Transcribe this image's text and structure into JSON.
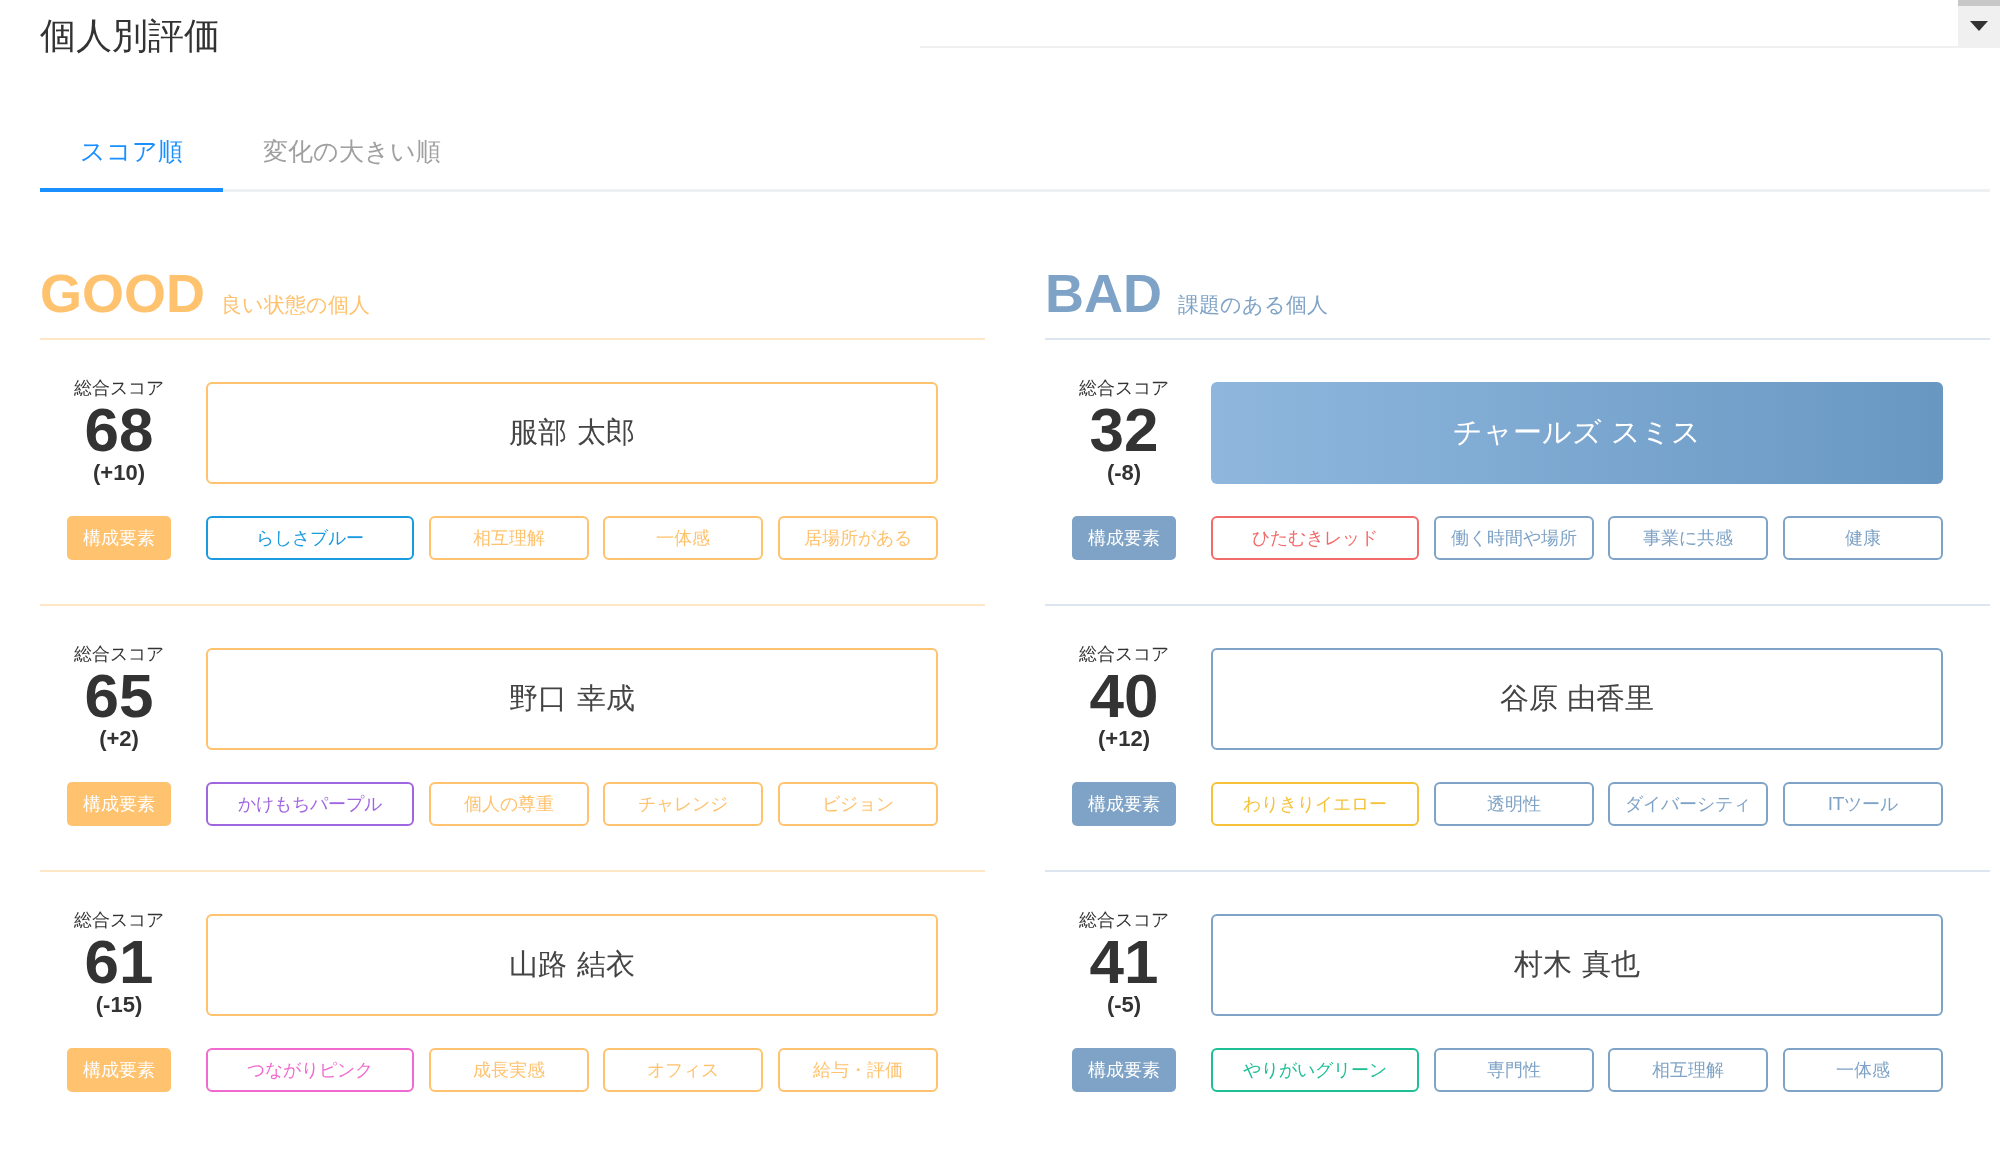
{
  "title": "個人別評価",
  "tabs": [
    {
      "label": "スコア順",
      "selected": true
    },
    {
      "label": "変化の大きい順",
      "selected": false
    }
  ],
  "sections": [
    {
      "kind": "good",
      "heading": "GOOD",
      "subheading": "良い状態の個人",
      "people": [
        {
          "score_label": "総合スコア",
          "score": "68",
          "change": "(+10)",
          "name": "服部 太郎",
          "highlighted": false,
          "components_label": "構成要素",
          "tags": [
            {
              "label": "らしさブルー",
              "color": "#1a9be0"
            },
            {
              "label": "相互理解",
              "color": "#ffc26e"
            },
            {
              "label": "一体感",
              "color": "#ffc26e"
            },
            {
              "label": "居場所がある",
              "color": "#ffc26e"
            }
          ]
        },
        {
          "score_label": "総合スコア",
          "score": "65",
          "change": "(+2)",
          "name": "野口 幸成",
          "highlighted": false,
          "components_label": "構成要素",
          "tags": [
            {
              "label": "かけもちパープル",
              "color": "#a066e0"
            },
            {
              "label": "個人の尊重",
              "color": "#ffc26e"
            },
            {
              "label": "チャレンジ",
              "color": "#ffc26e"
            },
            {
              "label": "ビジョン",
              "color": "#ffc26e"
            }
          ]
        },
        {
          "score_label": "総合スコア",
          "score": "61",
          "change": "(-15)",
          "name": "山路 結衣",
          "highlighted": false,
          "components_label": "構成要素",
          "tags": [
            {
              "label": "つながりピンク",
              "color": "#f06ad0"
            },
            {
              "label": "成長実感",
              "color": "#ffc26e"
            },
            {
              "label": "オフィス",
              "color": "#ffc26e"
            },
            {
              "label": "給与・評価",
              "color": "#ffc26e"
            }
          ]
        }
      ]
    },
    {
      "kind": "bad",
      "heading": "BAD",
      "subheading": "課題のある個人",
      "people": [
        {
          "score_label": "総合スコア",
          "score": "32",
          "change": "(-8)",
          "name": "チャールズ スミス",
          "highlighted": true,
          "components_label": "構成要素",
          "tags": [
            {
              "label": "ひたむきレッド",
              "color": "#f26b6b"
            },
            {
              "label": "働く時間や場所",
              "color": "#7fa3c6"
            },
            {
              "label": "事業に共感",
              "color": "#7fa3c6"
            },
            {
              "label": "健康",
              "color": "#7fa3c6"
            }
          ]
        },
        {
          "score_label": "総合スコア",
          "score": "40",
          "change": "(+12)",
          "name": "谷原 由香里",
          "highlighted": false,
          "components_label": "構成要素",
          "tags": [
            {
              "label": "わりきりイエロー",
              "color": "#f5c23a"
            },
            {
              "label": "透明性",
              "color": "#7fa3c6"
            },
            {
              "label": "ダイバーシティ",
              "color": "#7fa3c6"
            },
            {
              "label": "ITツール",
              "color": "#7fa3c6"
            }
          ]
        },
        {
          "score_label": "総合スコア",
          "score": "41",
          "change": "(-5)",
          "name": "村木 真也",
          "highlighted": false,
          "components_label": "構成要素",
          "tags": [
            {
              "label": "やりがいグリーン",
              "color": "#1fbf95"
            },
            {
              "label": "専門性",
              "color": "#7fa3c6"
            },
            {
              "label": "相互理解",
              "color": "#7fa3c6"
            },
            {
              "label": "一体感",
              "color": "#7fa3c6"
            }
          ]
        }
      ]
    }
  ]
}
